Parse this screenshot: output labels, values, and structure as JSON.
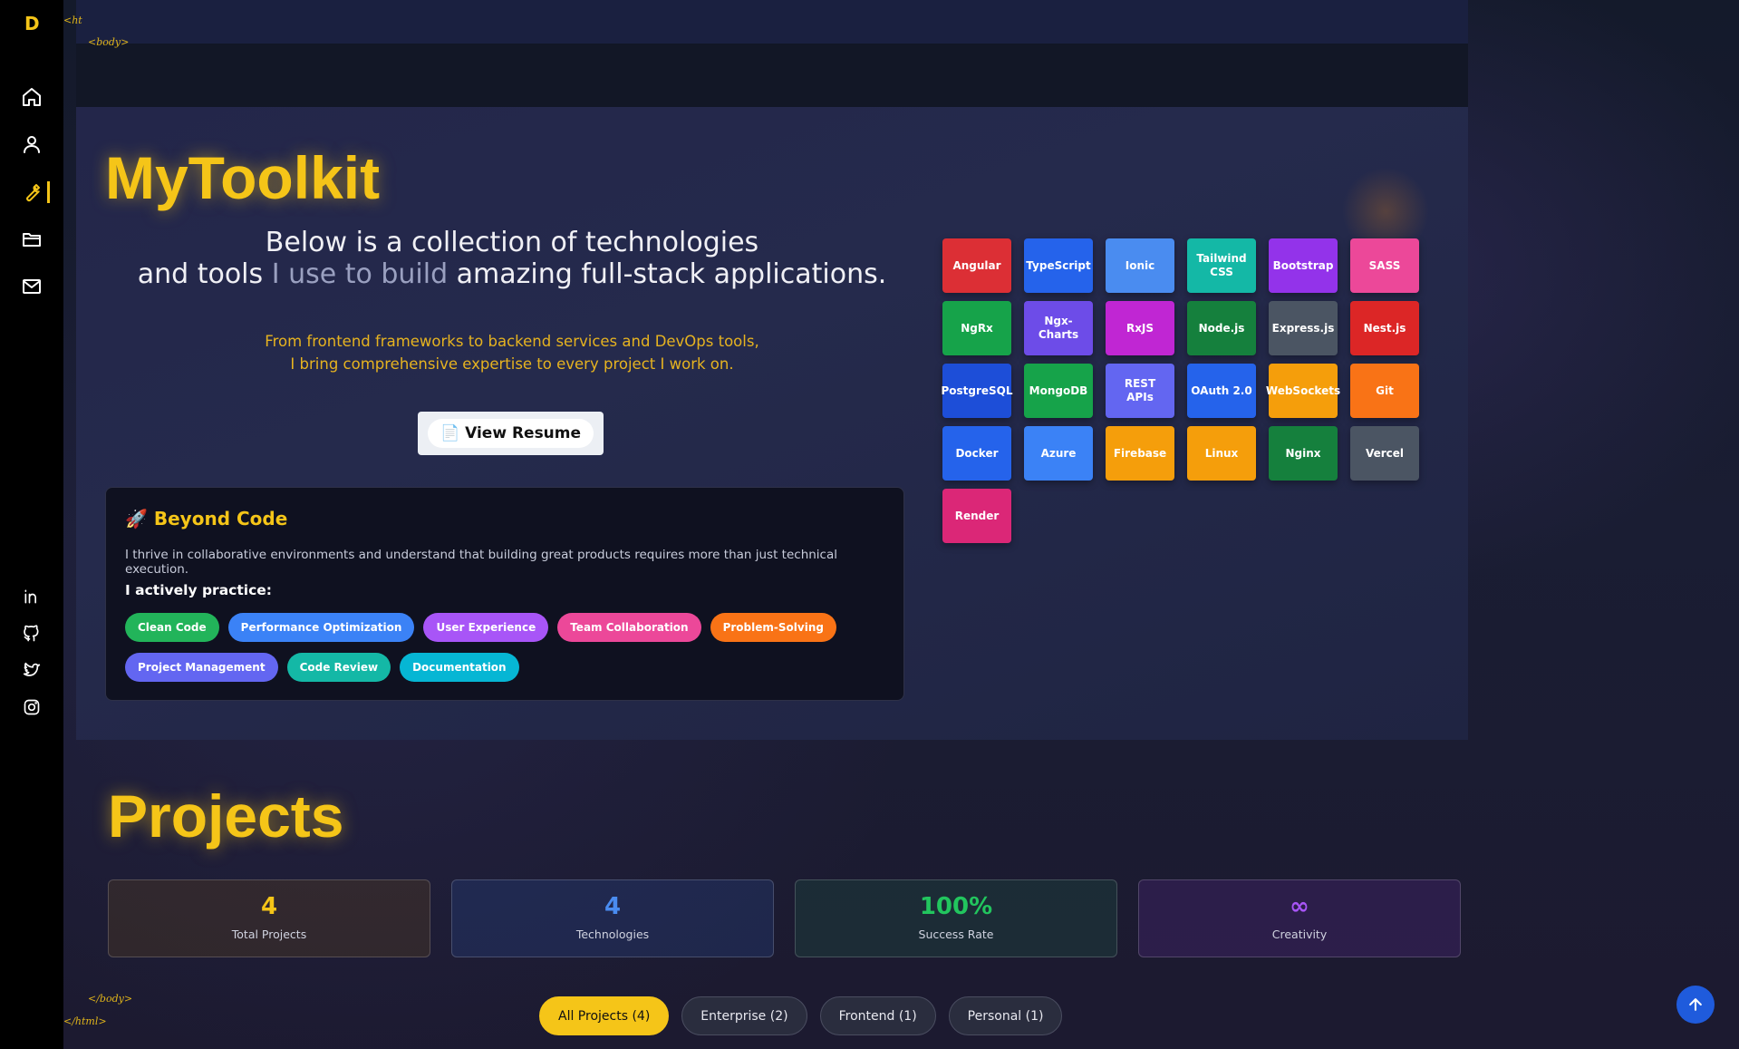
{
  "sidebar": {
    "logo": "D",
    "tag_open_html": "<ht",
    "tag_open_body": "<body>",
    "tag_close_body": "</body>",
    "tag_close_html": "</html>",
    "nav": [
      "home-icon",
      "user-icon",
      "wrench-icon",
      "folder-icon",
      "mail-icon"
    ],
    "active_nav": "wrench-icon",
    "social": [
      "linkedin-icon",
      "github-icon",
      "twitter-icon",
      "instagram-icon"
    ]
  },
  "toolkit": {
    "title": "MyToolkit",
    "intro_line1": "Below is a collection of technologies",
    "intro_line2_a": "and tools ",
    "intro_line2_b": "I use to build",
    "intro_line2_c": " amazing full-stack applications.",
    "sub_line1": "From frontend frameworks to backend services and DevOps tools,",
    "sub_line2": "I bring comprehensive expertise to every project I work on.",
    "resume_icon": "📄",
    "resume_label": "View Resume",
    "beyond": {
      "title": "🚀 Beyond Code",
      "text": "I thrive in collaborative environments and understand that building great products requires more than just technical execution.",
      "practice_label": "I actively practice:",
      "pills": [
        {
          "label": "Clean Code",
          "color": "#22b45a"
        },
        {
          "label": "Performance Optimization",
          "color": "#3b82f6"
        },
        {
          "label": "User Experience",
          "color": "#a855f7"
        },
        {
          "label": "Team Collaboration",
          "color": "#ec4899"
        },
        {
          "label": "Problem-Solving",
          "color": "#f97316"
        },
        {
          "label": "Project Management",
          "color": "#6366f1"
        },
        {
          "label": "Code Review",
          "color": "#14b8a6"
        },
        {
          "label": "Documentation",
          "color": "#06b6d4"
        }
      ]
    },
    "technologies": [
      {
        "label": "Angular",
        "color": "#dc2f35"
      },
      {
        "label": "TypeScript",
        "color": "#2563eb"
      },
      {
        "label": "Ionic",
        "color": "#4a8cf0"
      },
      {
        "label": "Tailwind CSS",
        "color": "#14b8a6"
      },
      {
        "label": "Bootstrap",
        "color": "#9333ea"
      },
      {
        "label": "SASS",
        "color": "#ec4899"
      },
      {
        "label": "NgRx",
        "color": "#16a34a"
      },
      {
        "label": "Ngx-Charts",
        "color": "#6d4ce8"
      },
      {
        "label": "RxJS",
        "color": "#c026d3"
      },
      {
        "label": "Node.js",
        "color": "#15803d"
      },
      {
        "label": "Express.js",
        "color": "#4b5563"
      },
      {
        "label": "Nest.js",
        "color": "#dc2626"
      },
      {
        "label": "PostgreSQL",
        "color": "#1d4ed8"
      },
      {
        "label": "MongoDB",
        "color": "#16a34a"
      },
      {
        "label": "REST APIs",
        "color": "#6366f1"
      },
      {
        "label": "OAuth 2.0",
        "color": "#2563eb"
      },
      {
        "label": "WebSockets",
        "color": "#f59e0b"
      },
      {
        "label": "Git",
        "color": "#f97316"
      },
      {
        "label": "Docker",
        "color": "#2563eb"
      },
      {
        "label": "Azure",
        "color": "#3b82f6"
      },
      {
        "label": "Firebase",
        "color": "#f59e0b"
      },
      {
        "label": "Linux",
        "color": "#f59e0b"
      },
      {
        "label": "Nginx",
        "color": "#15803d"
      },
      {
        "label": "Vercel",
        "color": "#4b5563"
      },
      {
        "label": "Render",
        "color": "#db2777"
      }
    ]
  },
  "projects": {
    "title": "Projects",
    "stats": [
      {
        "value": "4",
        "label": "Total Projects",
        "color": "#f5c518",
        "bg": "rgba(120,80,20,0.22)"
      },
      {
        "value": "4",
        "label": "Technologies",
        "color": "#4a8cf0",
        "bg": "rgba(40,70,140,0.30)"
      },
      {
        "value": "100%",
        "label": "Success Rate",
        "color": "#22c55e",
        "bg": "rgba(30,90,70,0.28)"
      },
      {
        "value": "∞",
        "label": "Creativity",
        "color": "#a855f7",
        "bg": "rgba(90,40,140,0.28)"
      }
    ],
    "filters": [
      {
        "label": "All Projects (4)",
        "active": true
      },
      {
        "label": "Enterprise (2)",
        "active": false
      },
      {
        "label": "Frontend (1)",
        "active": false
      },
      {
        "label": "Personal (1)",
        "active": false
      }
    ]
  }
}
